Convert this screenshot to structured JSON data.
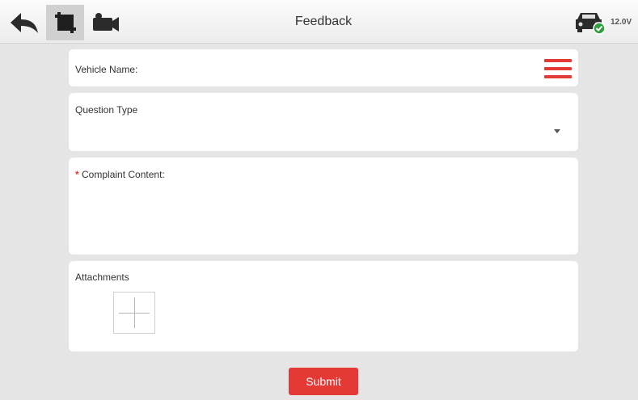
{
  "header": {
    "title": "Feedback",
    "voltage": "12.0V",
    "icons": {
      "back": "back-arrow-icon",
      "screenshot": "crop-icon",
      "record": "video-camera-icon",
      "vehicle_status": "car-connected-icon"
    }
  },
  "form": {
    "vehicle_name_label": "Vehicle Name:",
    "question_type_label": "Question Type",
    "complaint_required_mark": "*",
    "complaint_label": "Complaint Content:",
    "attachments_label": "Attachments"
  },
  "submit_label": "Submit",
  "colors": {
    "accent": "#e53935",
    "status_ok": "#2e9e3e"
  }
}
